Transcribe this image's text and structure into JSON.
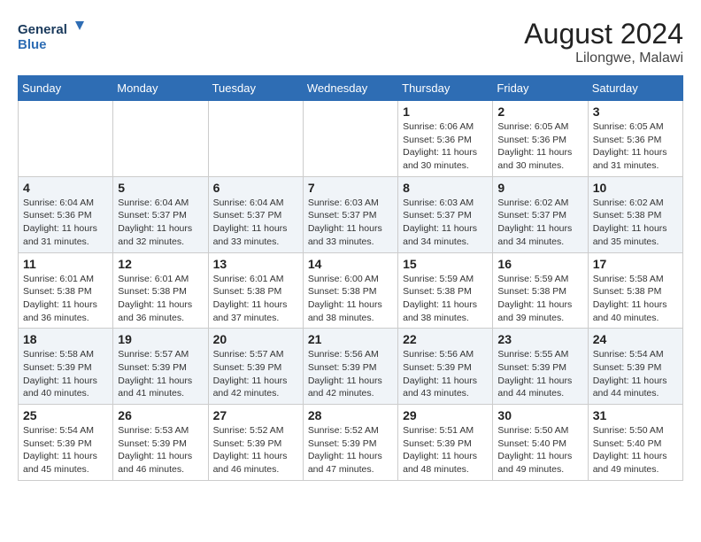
{
  "header": {
    "logo_line1": "General",
    "logo_line2": "Blue",
    "month_year": "August 2024",
    "location": "Lilongwe, Malawi"
  },
  "weekdays": [
    "Sunday",
    "Monday",
    "Tuesday",
    "Wednesday",
    "Thursday",
    "Friday",
    "Saturday"
  ],
  "weeks": [
    [
      {
        "day": "",
        "info": ""
      },
      {
        "day": "",
        "info": ""
      },
      {
        "day": "",
        "info": ""
      },
      {
        "day": "",
        "info": ""
      },
      {
        "day": "1",
        "info": "Sunrise: 6:06 AM\nSunset: 5:36 PM\nDaylight: 11 hours\nand 30 minutes."
      },
      {
        "day": "2",
        "info": "Sunrise: 6:05 AM\nSunset: 5:36 PM\nDaylight: 11 hours\nand 30 minutes."
      },
      {
        "day": "3",
        "info": "Sunrise: 6:05 AM\nSunset: 5:36 PM\nDaylight: 11 hours\nand 31 minutes."
      }
    ],
    [
      {
        "day": "4",
        "info": "Sunrise: 6:04 AM\nSunset: 5:36 PM\nDaylight: 11 hours\nand 31 minutes."
      },
      {
        "day": "5",
        "info": "Sunrise: 6:04 AM\nSunset: 5:37 PM\nDaylight: 11 hours\nand 32 minutes."
      },
      {
        "day": "6",
        "info": "Sunrise: 6:04 AM\nSunset: 5:37 PM\nDaylight: 11 hours\nand 33 minutes."
      },
      {
        "day": "7",
        "info": "Sunrise: 6:03 AM\nSunset: 5:37 PM\nDaylight: 11 hours\nand 33 minutes."
      },
      {
        "day": "8",
        "info": "Sunrise: 6:03 AM\nSunset: 5:37 PM\nDaylight: 11 hours\nand 34 minutes."
      },
      {
        "day": "9",
        "info": "Sunrise: 6:02 AM\nSunset: 5:37 PM\nDaylight: 11 hours\nand 34 minutes."
      },
      {
        "day": "10",
        "info": "Sunrise: 6:02 AM\nSunset: 5:38 PM\nDaylight: 11 hours\nand 35 minutes."
      }
    ],
    [
      {
        "day": "11",
        "info": "Sunrise: 6:01 AM\nSunset: 5:38 PM\nDaylight: 11 hours\nand 36 minutes."
      },
      {
        "day": "12",
        "info": "Sunrise: 6:01 AM\nSunset: 5:38 PM\nDaylight: 11 hours\nand 36 minutes."
      },
      {
        "day": "13",
        "info": "Sunrise: 6:01 AM\nSunset: 5:38 PM\nDaylight: 11 hours\nand 37 minutes."
      },
      {
        "day": "14",
        "info": "Sunrise: 6:00 AM\nSunset: 5:38 PM\nDaylight: 11 hours\nand 38 minutes."
      },
      {
        "day": "15",
        "info": "Sunrise: 5:59 AM\nSunset: 5:38 PM\nDaylight: 11 hours\nand 38 minutes."
      },
      {
        "day": "16",
        "info": "Sunrise: 5:59 AM\nSunset: 5:38 PM\nDaylight: 11 hours\nand 39 minutes."
      },
      {
        "day": "17",
        "info": "Sunrise: 5:58 AM\nSunset: 5:38 PM\nDaylight: 11 hours\nand 40 minutes."
      }
    ],
    [
      {
        "day": "18",
        "info": "Sunrise: 5:58 AM\nSunset: 5:39 PM\nDaylight: 11 hours\nand 40 minutes."
      },
      {
        "day": "19",
        "info": "Sunrise: 5:57 AM\nSunset: 5:39 PM\nDaylight: 11 hours\nand 41 minutes."
      },
      {
        "day": "20",
        "info": "Sunrise: 5:57 AM\nSunset: 5:39 PM\nDaylight: 11 hours\nand 42 minutes."
      },
      {
        "day": "21",
        "info": "Sunrise: 5:56 AM\nSunset: 5:39 PM\nDaylight: 11 hours\nand 42 minutes."
      },
      {
        "day": "22",
        "info": "Sunrise: 5:56 AM\nSunset: 5:39 PM\nDaylight: 11 hours\nand 43 minutes."
      },
      {
        "day": "23",
        "info": "Sunrise: 5:55 AM\nSunset: 5:39 PM\nDaylight: 11 hours\nand 44 minutes."
      },
      {
        "day": "24",
        "info": "Sunrise: 5:54 AM\nSunset: 5:39 PM\nDaylight: 11 hours\nand 44 minutes."
      }
    ],
    [
      {
        "day": "25",
        "info": "Sunrise: 5:54 AM\nSunset: 5:39 PM\nDaylight: 11 hours\nand 45 minutes."
      },
      {
        "day": "26",
        "info": "Sunrise: 5:53 AM\nSunset: 5:39 PM\nDaylight: 11 hours\nand 46 minutes."
      },
      {
        "day": "27",
        "info": "Sunrise: 5:52 AM\nSunset: 5:39 PM\nDaylight: 11 hours\nand 46 minutes."
      },
      {
        "day": "28",
        "info": "Sunrise: 5:52 AM\nSunset: 5:39 PM\nDaylight: 11 hours\nand 47 minutes."
      },
      {
        "day": "29",
        "info": "Sunrise: 5:51 AM\nSunset: 5:39 PM\nDaylight: 11 hours\nand 48 minutes."
      },
      {
        "day": "30",
        "info": "Sunrise: 5:50 AM\nSunset: 5:40 PM\nDaylight: 11 hours\nand 49 minutes."
      },
      {
        "day": "31",
        "info": "Sunrise: 5:50 AM\nSunset: 5:40 PM\nDaylight: 11 hours\nand 49 minutes."
      }
    ]
  ]
}
